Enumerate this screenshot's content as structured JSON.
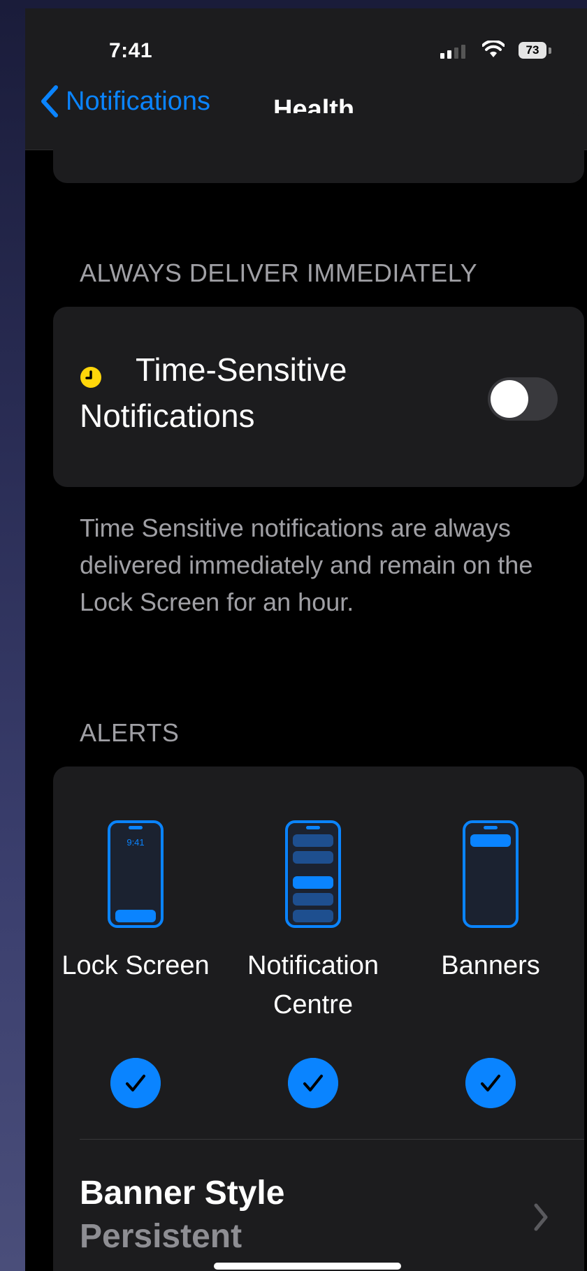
{
  "status_bar": {
    "time": "7:41",
    "battery": "73"
  },
  "nav": {
    "back_label": "Notifications",
    "title": "Health"
  },
  "time_sensitive": {
    "section_header": "ALWAYS DELIVER IMMEDIATELY",
    "label_line1": "Time-Sensitive",
    "label_line2": "Notifications",
    "toggle_on": false,
    "footnote": "Time Sensitive notifications are always delivered immediately and remain on the Lock Screen for an hour."
  },
  "alerts": {
    "section_header": "ALERTS",
    "lock_screen_time": "9:41",
    "options": [
      {
        "line1": "Lock Screen",
        "line2": "",
        "checked": true
      },
      {
        "line1": "Notification",
        "line2": "Centre",
        "checked": true
      },
      {
        "line1": "Banners",
        "line2": "",
        "checked": true
      }
    ]
  },
  "banner_style": {
    "title": "Banner Style",
    "value": "Persistent"
  },
  "colors": {
    "accent": "#0a84ff",
    "time_sensitive_icon": "#ffd60a",
    "background": "#000000",
    "card": "#1c1c1e"
  }
}
